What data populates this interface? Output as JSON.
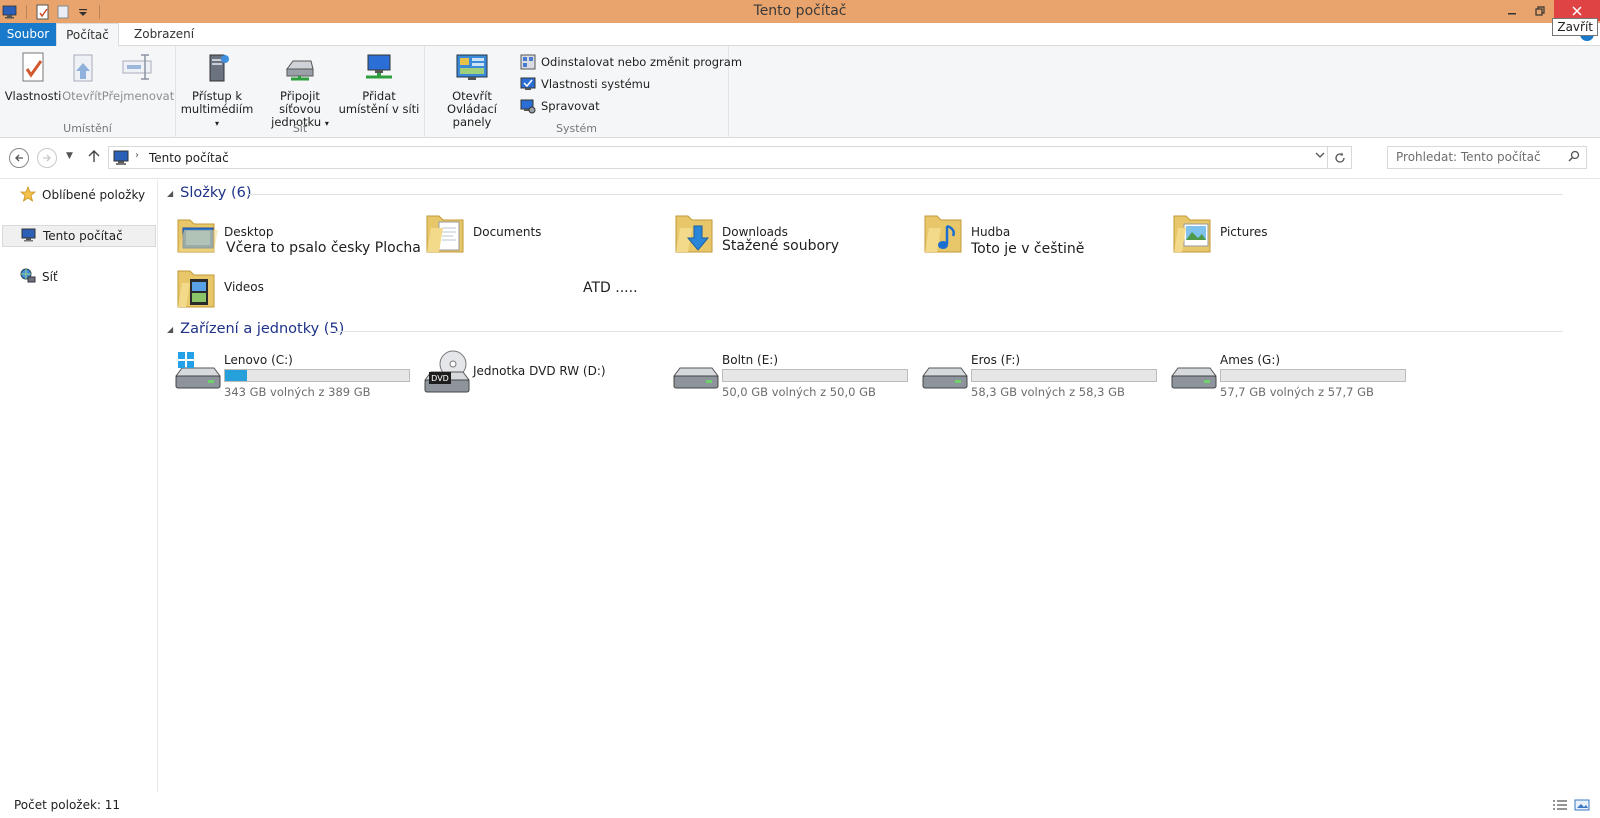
{
  "window": {
    "title": "Tento počítač",
    "close_tooltip": "Zavřít"
  },
  "ribbon_tabs": {
    "file": "Soubor",
    "computer": "Počítač",
    "view": "Zobrazení"
  },
  "ribbon": {
    "location": {
      "label": "Umístění",
      "properties": "Vlastnosti",
      "open": "Otevřít",
      "rename": "Přejmenovat"
    },
    "network": {
      "label": "Síť",
      "media_line1": "Přístup k",
      "media_line2": "multimédiím",
      "map_line1": "Připojit síťovou",
      "map_line2": "jednotku",
      "add_line1": "Přidat",
      "add_line2": "umístění v síti"
    },
    "system": {
      "label": "Systém",
      "control_line1": "Otevřít Ovládací",
      "control_line2": "panely",
      "uninstall": "Odinstalovat nebo změnit program",
      "sys_props": "Vlastnosti systému",
      "manage": "Spravovat"
    }
  },
  "address_bar": {
    "path": "Tento počítač",
    "search_placeholder": "Prohledat: Tento počítač"
  },
  "nav_pane": {
    "favorites": "Oblíbené položky",
    "this_pc": "Tento počítač",
    "network": "Síť"
  },
  "folders_section": {
    "title": "Složky (6)",
    "items": [
      {
        "name": "Desktop",
        "subtitle": "Včera to psalo česky Plocha"
      },
      {
        "name": "Documents",
        "subtitle": ""
      },
      {
        "name": "Downloads",
        "subtitle": "Stažené soubory"
      },
      {
        "name": "Hudba",
        "subtitle": "Toto je v češtině"
      },
      {
        "name": "Pictures",
        "subtitle": ""
      },
      {
        "name": "Videos",
        "subtitle": ""
      }
    ],
    "note": "ATD ....."
  },
  "drives_section": {
    "title": "Zařízení a jednotky (5)",
    "items": [
      {
        "name": "Lenovo (C:)",
        "free": "343 GB volných z 389 GB",
        "used_fraction": 0.118
      },
      {
        "name": "Jednotka DVD RW (D:)"
      },
      {
        "name": "Boltn (E:)",
        "free": "50,0 GB volných z 50,0 GB",
        "used_fraction": 0.0
      },
      {
        "name": "Eros (F:)",
        "free": "58,3 GB volných z 58,3 GB",
        "used_fraction": 0.0
      },
      {
        "name": "Ames (G:)",
        "free": "57,7 GB volných z 57,7 GB",
        "used_fraction": 0.0
      }
    ]
  },
  "status_bar": {
    "item_count": "Počet položek: 11"
  },
  "colors": {
    "titlebar": "#e8a46c",
    "file_tab": "#1979ca",
    "close_button": "#e04343",
    "usage_bar": "#26a0da",
    "section_header": "#1e3287"
  }
}
